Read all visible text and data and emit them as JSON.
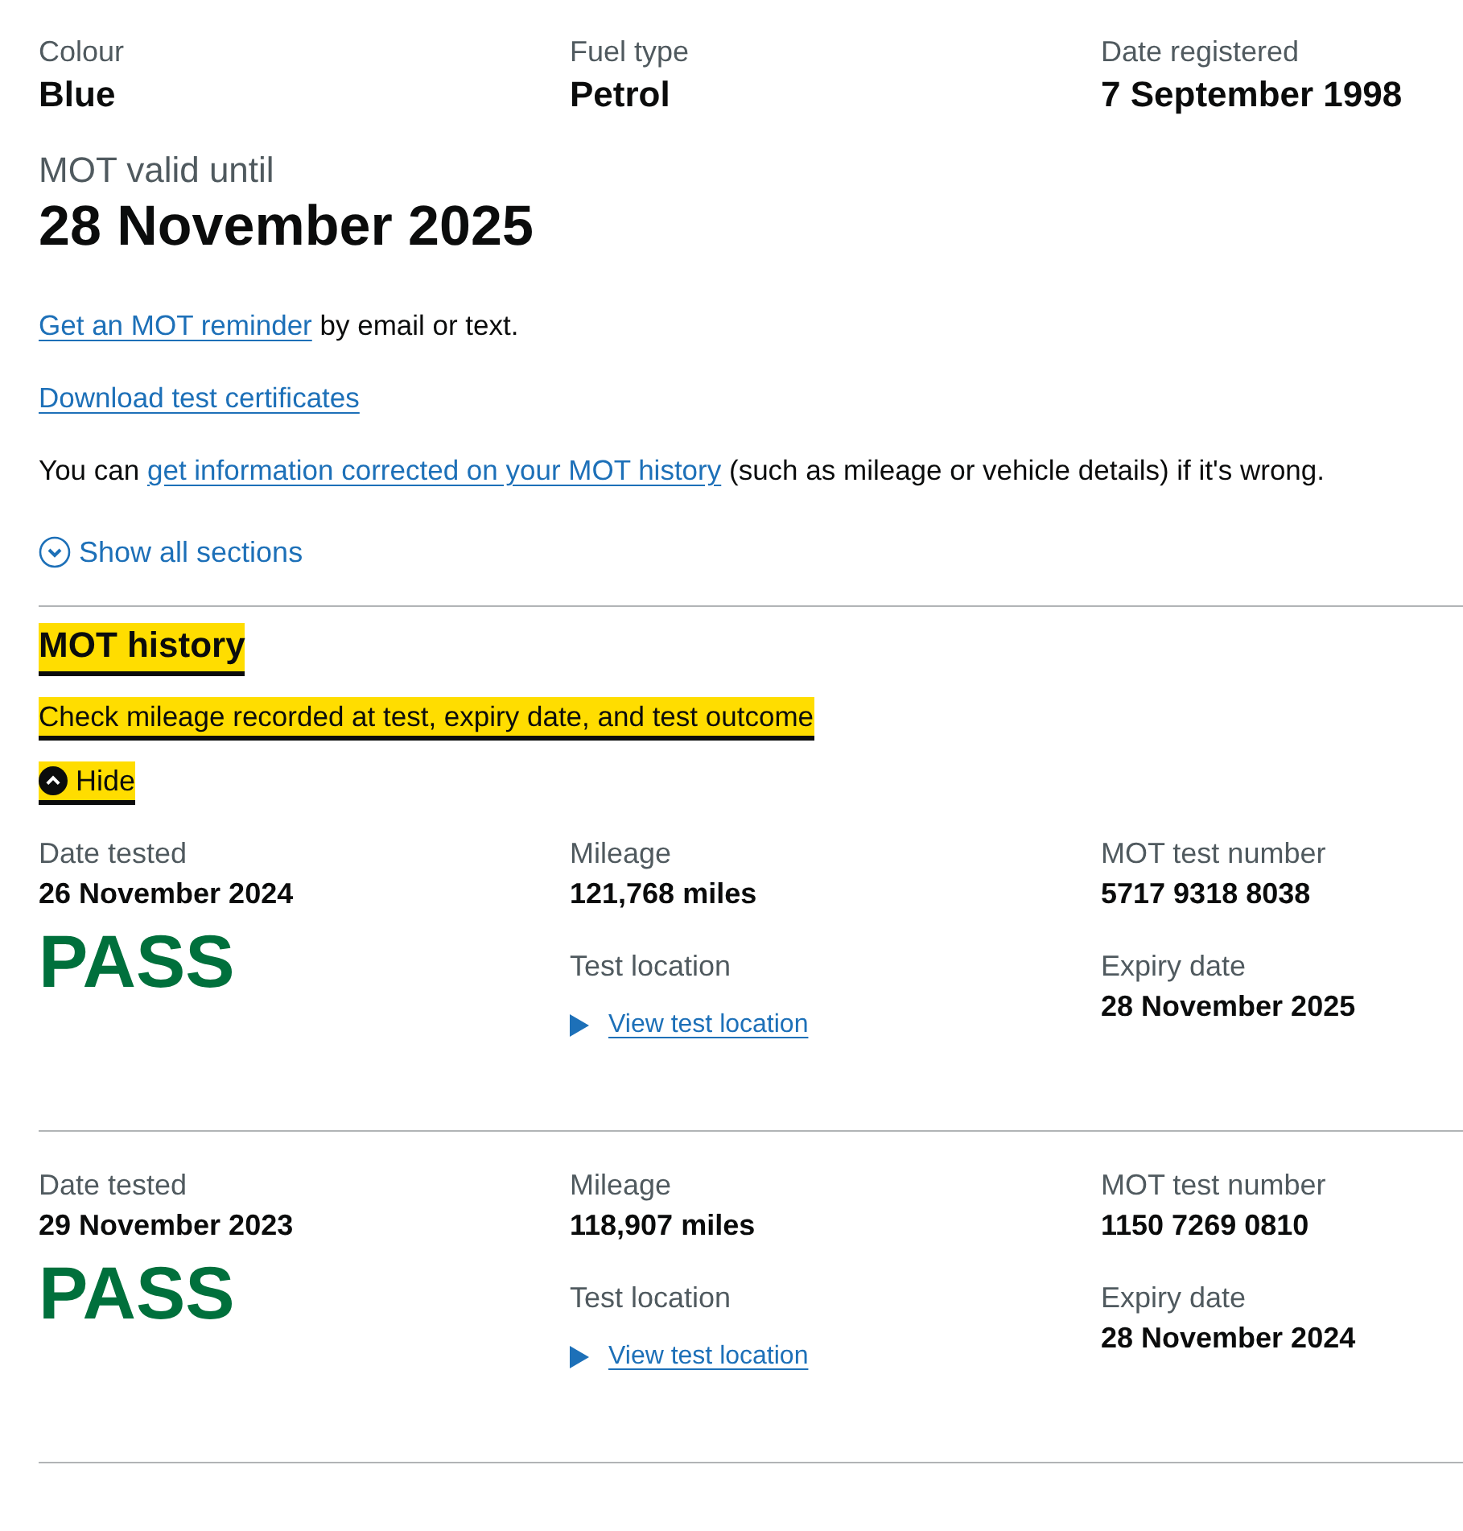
{
  "vehicle_details": [
    {
      "label": "Colour",
      "value": "Blue"
    },
    {
      "label": "Fuel type",
      "value": "Petrol"
    },
    {
      "label": "Date registered",
      "value": "7 September 1998"
    }
  ],
  "mot_valid": {
    "label": "MOT valid until",
    "value": "28 November 2025"
  },
  "reminder": {
    "link": "Get an MOT reminder",
    "text": " by email or text."
  },
  "download_link": "Download test certificates",
  "correction": {
    "before": "You can ",
    "link": "get information corrected on your MOT history",
    "after": " (such as mileage or vehicle details) if it's wrong."
  },
  "show_all_sections": "Show all sections",
  "section": {
    "title": "MOT history",
    "summary": "Check mileage recorded at test, expiry date, and test outcome",
    "toggle": "Hide",
    "expanded": true
  },
  "tests": [
    {
      "date_label": "Date tested",
      "date": "26 November 2024",
      "result": "PASS",
      "mileage_label": "Mileage",
      "mileage": "121,768 miles",
      "location_label": "Test location",
      "location_link": "View test location",
      "number_label": "MOT test number",
      "number": "5717 9318 8038",
      "expiry_label": "Expiry date",
      "expiry": "28 November 2025"
    },
    {
      "date_label": "Date tested",
      "date": "29 November 2023",
      "result": "PASS",
      "mileage_label": "Mileage",
      "mileage": "118,907 miles",
      "location_label": "Test location",
      "location_link": "View test location",
      "number_label": "MOT test number",
      "number": "1150 7269 0810",
      "expiry_label": "Expiry date",
      "expiry": "28 November 2024"
    }
  ]
}
